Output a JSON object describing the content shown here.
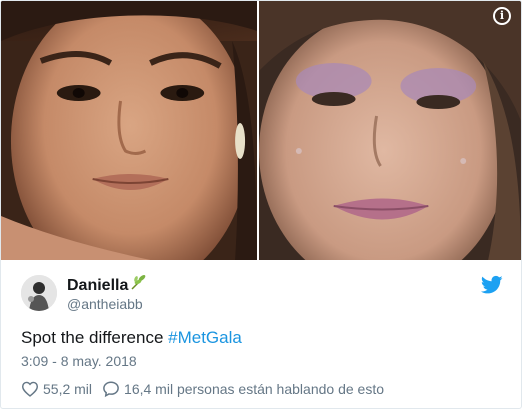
{
  "tweet": {
    "display_name": "Daniella",
    "handle": "@antheiabb",
    "text": "Spot the difference ",
    "hashtag": "#MetGala",
    "timestamp": "3:09 - 8 may. 2018",
    "likes": "55,2 mil",
    "talking": "16,4 mil personas están hablando de esto"
  },
  "icons": {
    "info": "info-icon",
    "verified_leaf": "leaf-emoji-icon",
    "brand": "twitter-bird-icon",
    "like": "heart-icon",
    "reply": "speech-bubble-icon"
  },
  "colors": {
    "link": "#1b95e0",
    "secondary_text": "#657786",
    "brand_blue": "#1da1f2",
    "primary_text": "#14171a"
  }
}
